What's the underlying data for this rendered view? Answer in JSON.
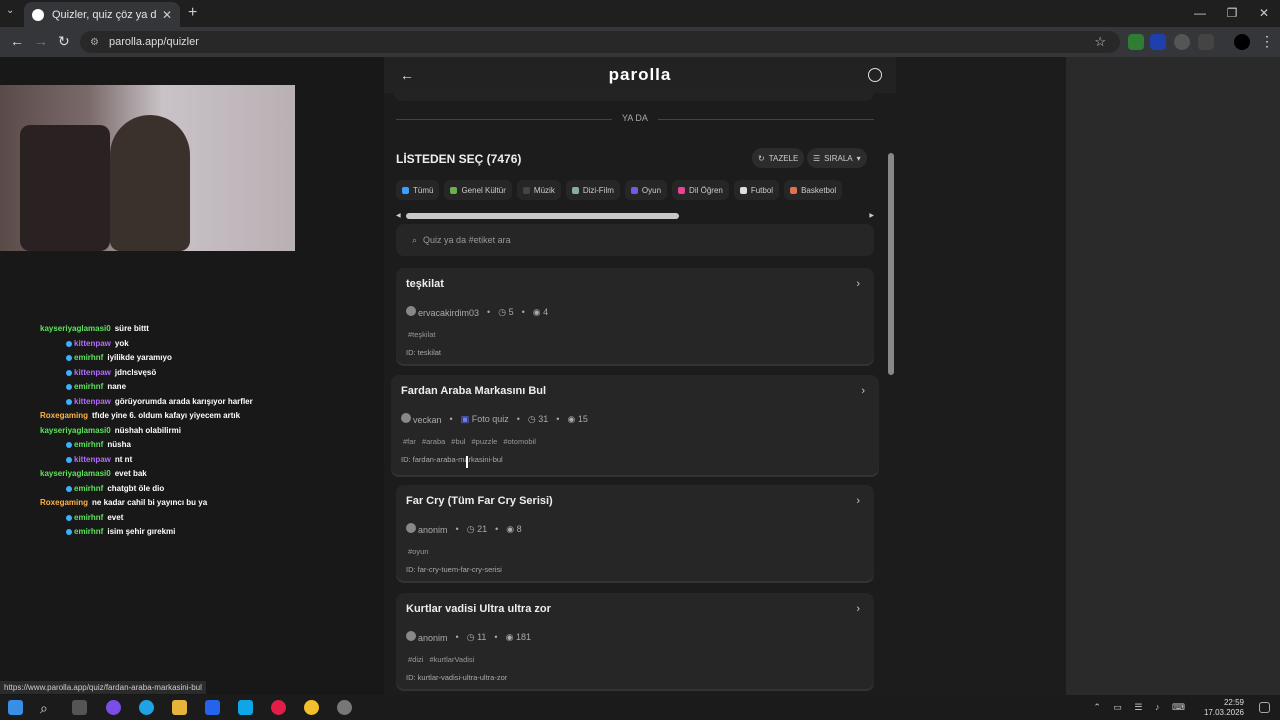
{
  "browser": {
    "tab_title": "Quizler, quiz çöz ya da quiz oluş",
    "url": "parolla.app/quizler",
    "tab_menu": "⌄",
    "close": "✕",
    "newtab": "+"
  },
  "window": {
    "minimize": "—",
    "restore": "❐",
    "close": "✕"
  },
  "app": {
    "logo": "parolla",
    "or_text": "YA DA",
    "list_title": "LİSTEDEN SEÇ (7476)",
    "refresh_label": "TAZELE",
    "sort_label": "SIRALA",
    "search_placeholder": "Quiz ya da #etiket ara"
  },
  "categories": [
    {
      "label": "Tümü",
      "color": "#3aa0ff"
    },
    {
      "label": "Genel Kültür",
      "color": "#6ab04c"
    },
    {
      "label": "Müzik",
      "color": "#444"
    },
    {
      "label": "Dizi-Film",
      "color": "#8aa"
    },
    {
      "label": "Oyun",
      "color": "#6c5ce7"
    },
    {
      "label": "Dil Öğren",
      "color": "#e84393"
    },
    {
      "label": "Futbol",
      "color": "#ddd"
    },
    {
      "label": "Basketbol",
      "color": "#e17055"
    }
  ],
  "quizzes": [
    {
      "title": "teşkilat",
      "author": "ervacakirdim03",
      "type": "",
      "questions": "5",
      "views": "4",
      "tags": [
        "#teşkilat"
      ],
      "id": "ID: teskilat"
    },
    {
      "title": "Fardan Araba Markasını Bul",
      "author": "veckan",
      "type": "Foto quiz",
      "questions": "31",
      "views": "15",
      "tags": [
        "#far",
        "#araba",
        "#bul",
        "#puzzle",
        "#otomobil"
      ],
      "id": "ID: fardan-araba-markasini-bul"
    },
    {
      "title": "Far Cry (Tüm Far Cry Serisi)",
      "author": "anonim",
      "type": "",
      "questions": "21",
      "views": "8",
      "tags": [
        "#oyun"
      ],
      "id": "ID: far-cry-tuem-far-cry-serisi"
    },
    {
      "title": "Kurtlar vadisi Ultra ultra zor",
      "author": "anonim",
      "type": "",
      "questions": "11",
      "views": "181",
      "tags": [
        "#dizi",
        "#kurtlarVadisi"
      ],
      "id": "ID: kurtlar-vadisi-ultra-ultra-zor"
    }
  ],
  "chat": [
    {
      "user": "kayseriyaglamasi0",
      "color": "#5de35d",
      "msg": "süre bittt",
      "indent": 40
    },
    {
      "user": "kittenpaw",
      "color": "#b36bff",
      "msg": "yok",
      "indent": 66
    },
    {
      "user": "emirhnf",
      "color": "#5de35d",
      "msg": "iyilikde yaramıyo",
      "indent": 66
    },
    {
      "user": "kittenpaw",
      "color": "#b36bff",
      "msg": "jdnclsvęsö",
      "indent": 66
    },
    {
      "user": "emirhnf",
      "color": "#5de35d",
      "msg": "nane",
      "indent": 66
    },
    {
      "user": "kittenpaw",
      "color": "#b36bff",
      "msg": "görüyorumda arada karışıyor harfler",
      "indent": 66
    },
    {
      "user": "Roxegaming",
      "color": "#ffb347",
      "msg": "tfıde yine 6. oldum kafayı yiyecem artık",
      "indent": 40
    },
    {
      "user": "kayseriyaglamasi0",
      "color": "#5de35d",
      "msg": "nüshah olabilirmi",
      "indent": 40
    },
    {
      "user": "emirhnf",
      "color": "#5de35d",
      "msg": "nüsha",
      "indent": 66
    },
    {
      "user": "kittenpaw",
      "color": "#b36bff",
      "msg": "nt nt",
      "indent": 66
    },
    {
      "user": "kayseriyaglamasi0",
      "color": "#5de35d",
      "msg": "evet bak",
      "indent": 40
    },
    {
      "user": "emirhnf",
      "color": "#5de35d",
      "msg": "chatgbt öle dio",
      "indent": 66
    },
    {
      "user": "Roxegaming",
      "color": "#ffb347",
      "msg": "ne kadar cahil bi yayıncı bu ya",
      "indent": 40
    },
    {
      "user": "emirhnf",
      "color": "#5de35d",
      "msg": "evet",
      "indent": 66
    },
    {
      "user": "emirhnf",
      "color": "#5de35d",
      "msg": "isim şehir gırekmi",
      "indent": 66
    }
  ],
  "status_url": "https://www.parolla.app/quiz/fardan-araba-markasini-bul",
  "clock": {
    "time": "22:59",
    "date": "17.03.2026"
  }
}
